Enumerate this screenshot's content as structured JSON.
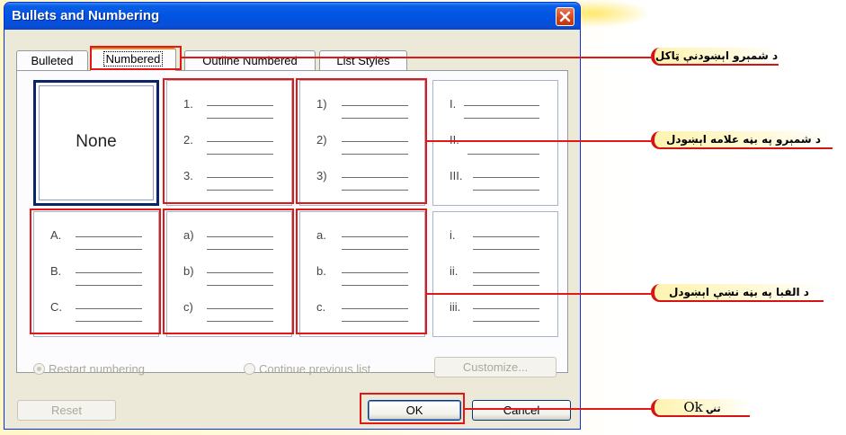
{
  "dialog": {
    "title": "Bullets and Numbering",
    "tabs": [
      {
        "label": "Bulleted",
        "active": false
      },
      {
        "label": "Numbered",
        "active": true
      },
      {
        "label": "Outline Numbered",
        "active": false
      },
      {
        "label": "List Styles",
        "active": false
      }
    ],
    "none_label": "None",
    "options": [
      {
        "markers": [
          "1.",
          "2.",
          "3."
        ]
      },
      {
        "markers": [
          "1)",
          "2)",
          "3)"
        ]
      },
      {
        "markers": [
          "I.",
          "II.",
          "III."
        ]
      },
      {
        "markers": [
          "A.",
          "B.",
          "C."
        ]
      },
      {
        "markers": [
          "a)",
          "b)",
          "c)"
        ]
      },
      {
        "markers": [
          "a.",
          "b.",
          "c."
        ]
      },
      {
        "markers": [
          "i.",
          "ii.",
          "iii."
        ]
      }
    ],
    "restart_label": "Restart numbering",
    "continue_label": "Continue previous list",
    "customize_label": "Customize...",
    "reset_label": "Reset",
    "ok_label": "OK",
    "cancel_label": "Cancel"
  },
  "callouts": {
    "tab_callout": "د شمېرو اېښودنې ټاکل",
    "numbers_callout": "د شمېرو په بڼه علامه اېښودل",
    "letters_callout": "د الفبا په بڼه نښې اېښودل",
    "ok_word": "Ok",
    "ok_suffix": "تنۍ"
  },
  "colors": {
    "highlight": "#e01818",
    "title_bar": "#0054e3",
    "callout_fill": "#fff3b0"
  }
}
